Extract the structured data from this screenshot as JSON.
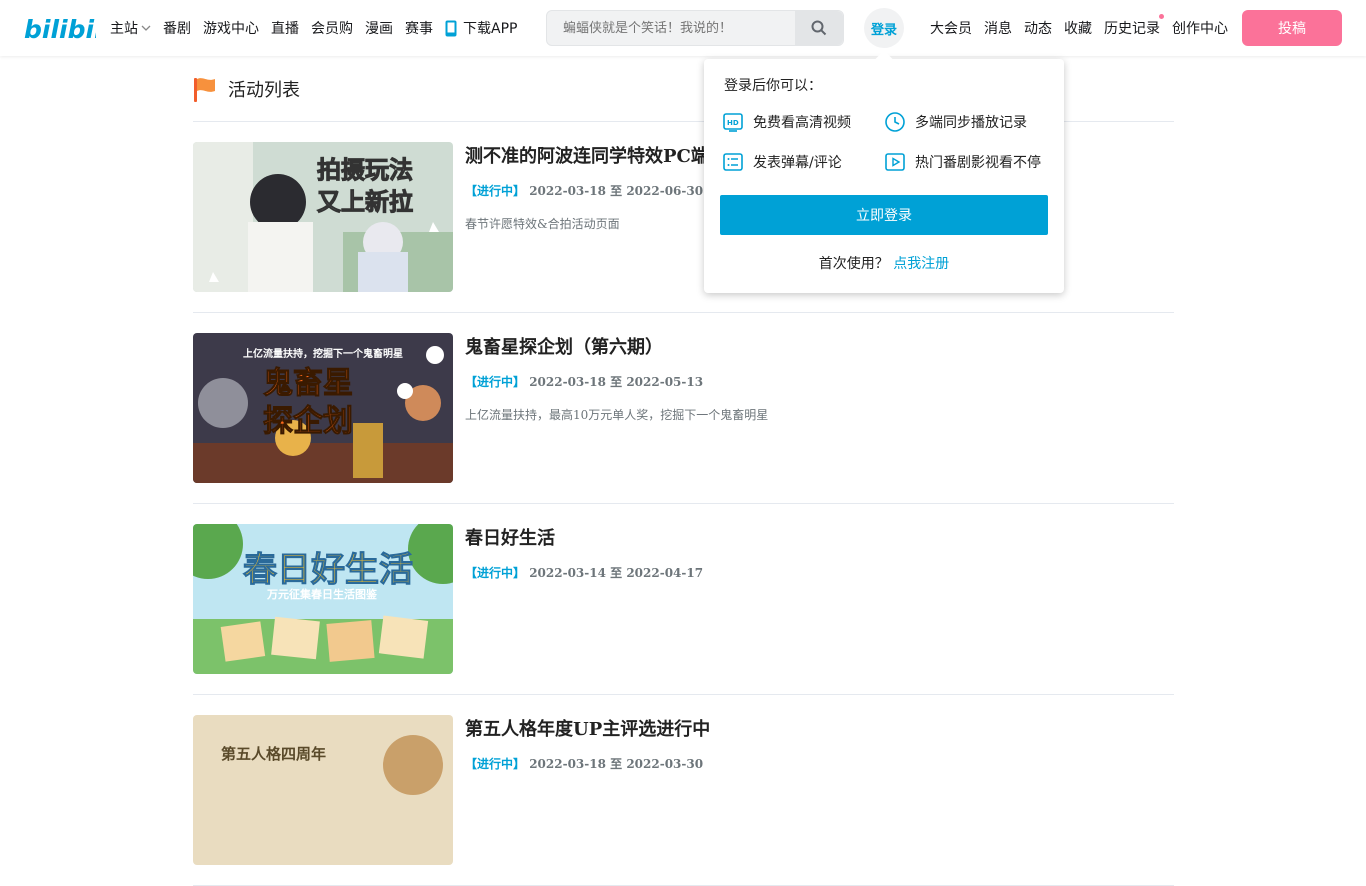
{
  "header": {
    "logo_text": "bilibili",
    "nav_left": [
      {
        "label": "主站"
      },
      {
        "label": "番剧"
      },
      {
        "label": "游戏中心"
      },
      {
        "label": "直播"
      },
      {
        "label": "会员购"
      },
      {
        "label": "漫画"
      },
      {
        "label": "赛事"
      },
      {
        "label": "下载APP"
      }
    ],
    "search_placeholder": "蝙蝠侠就是个笑话！我说的！",
    "login_label": "登录",
    "nav_right": [
      {
        "label": "大会员"
      },
      {
        "label": "消息"
      },
      {
        "label": "动态"
      },
      {
        "label": "收藏"
      },
      {
        "label": "历史记录"
      },
      {
        "label": "创作中心"
      }
    ],
    "upload_label": "投稿"
  },
  "page": {
    "title": "活动列表"
  },
  "activities": [
    {
      "title": "测不准的阿波连同学特效PC端",
      "status": "【进行中】",
      "dates": "2022-03-18 至 2022-06-30",
      "desc": "春节许愿特效&合拍活动页面",
      "thumb_text": "拍摄玩法 又上新拉"
    },
    {
      "title": "鬼畜星探企划（第六期）",
      "status": "【进行中】",
      "dates": "2022-03-18 至 2022-05-13",
      "desc": "上亿流量扶持，最高10万元单人奖，挖掘下一个鬼畜明星",
      "thumb_text": "鬼畜星探企划",
      "thumb_sub": "上亿流量扶持，挖掘下一个鬼畜明星"
    },
    {
      "title": "春日好生活",
      "status": "【进行中】",
      "dates": "2022-03-14 至 2022-04-17",
      "desc": "",
      "thumb_text": "春日好生活",
      "thumb_sub": "万元征集春日生活图鉴"
    },
    {
      "title": "第五人格年度UP主评选进行中",
      "status": "【进行中】",
      "dates": "2022-03-18 至 2022-03-30",
      "desc": "",
      "thumb_text": "第五人格四周年"
    }
  ],
  "login_popover": {
    "tip": "登录后你可以：",
    "perks": [
      {
        "label": "免费看高清视频",
        "icon": "hd-icon"
      },
      {
        "label": "多端同步播放记录",
        "icon": "clock-icon"
      },
      {
        "label": "发表弹幕/评论",
        "icon": "list-icon"
      },
      {
        "label": "热门番剧影视看不停",
        "icon": "play-icon"
      }
    ],
    "login_button": "立即登录",
    "first_use": "首次使用？",
    "register_link": "点我注册"
  },
  "colors": {
    "brand_blue": "#00a1d6",
    "brand_pink": "#fb7299"
  }
}
